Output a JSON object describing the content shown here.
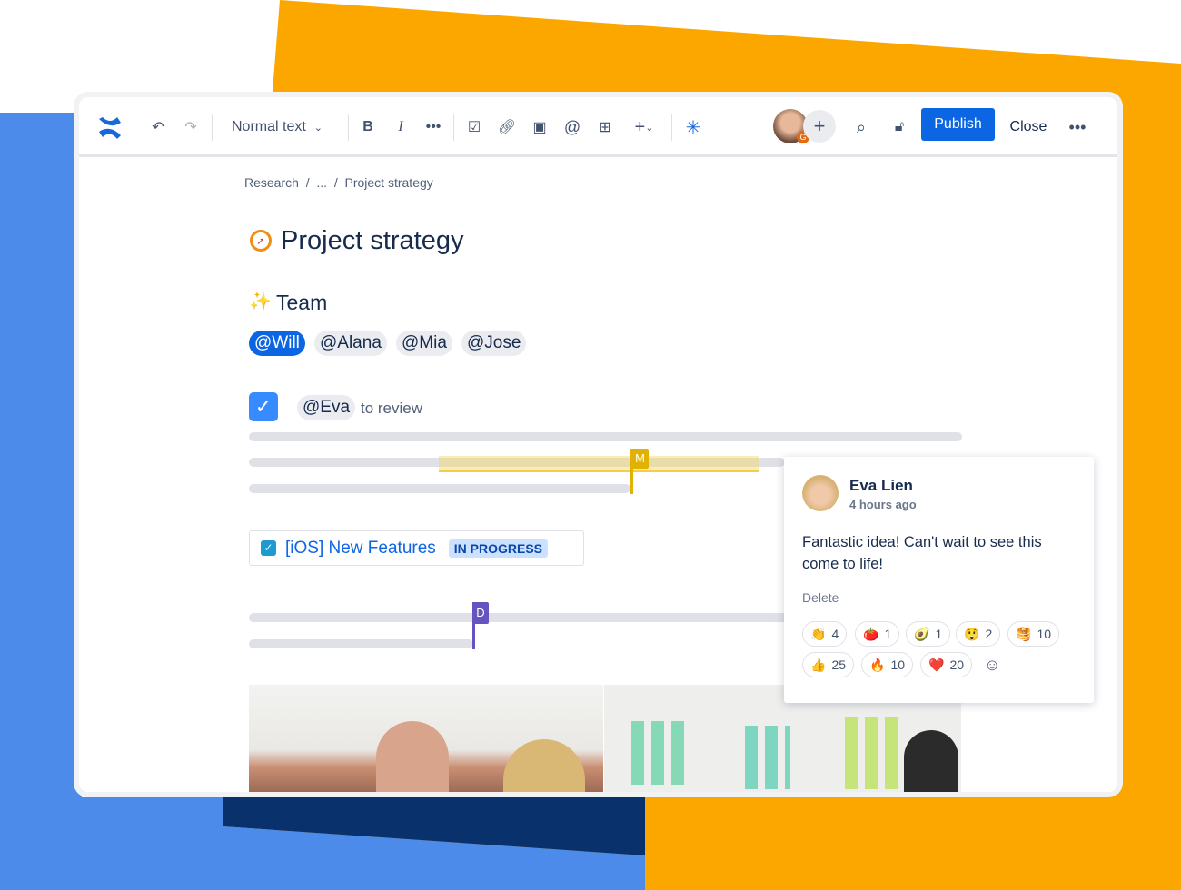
{
  "toolbar": {
    "text_style": "Normal text",
    "publish": "Publish",
    "close": "Close",
    "avatar_badge": "G"
  },
  "breadcrumb": {
    "items": [
      "Research",
      "...",
      "Project strategy"
    ],
    "sep": "/"
  },
  "page": {
    "title": "Project strategy",
    "section": "Team",
    "mentions": [
      "@Will",
      "@Alana",
      "@Mia",
      "@Jose"
    ],
    "task": {
      "mention": "@Eva",
      "text": "to review"
    },
    "jira": {
      "title": "[iOS] New Features",
      "status": "IN PROGRESS"
    },
    "cursors": [
      {
        "label": "M",
        "color": "#f5b800"
      },
      {
        "label": "D",
        "color": "#6554c0"
      }
    ]
  },
  "comment": {
    "author": "Eva Lien",
    "time": "4 hours ago",
    "text": "Fantastic idea! Can't wait to see this come to life!",
    "delete": "Delete",
    "reactions": [
      {
        "emoji": "👏",
        "count": "4"
      },
      {
        "emoji": "🍅",
        "count": "1"
      },
      {
        "emoji": "🥑",
        "count": "1"
      },
      {
        "emoji": "😲",
        "count": "2"
      },
      {
        "emoji": "🥞",
        "count": "10"
      },
      {
        "emoji": "👍",
        "count": "25"
      },
      {
        "emoji": "🔥",
        "count": "10"
      },
      {
        "emoji": "❤️",
        "count": "20"
      }
    ]
  },
  "colors": {
    "brand": "#0c66e4",
    "orange": "#fca700",
    "blue": "#4c8bea",
    "navy": "#09326c"
  }
}
